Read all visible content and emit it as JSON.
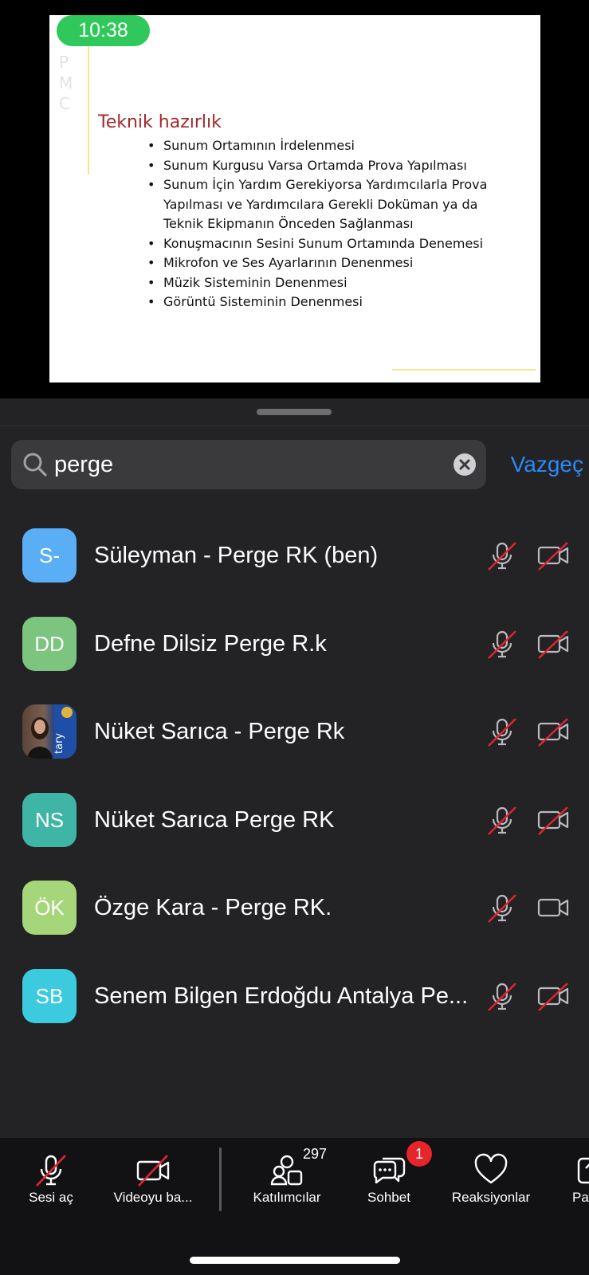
{
  "status": {
    "time": "10:38"
  },
  "slide": {
    "title": "Teknik hazırlık",
    "bullets": [
      "Sunum Ortamının İrdelenmesi",
      "Sunum Kurgusu Varsa Ortamda Prova Yapılması",
      "Sunum İçin Yardım Gerekiyorsa Yardımcılarla Prova Yapılması ve Yardımcılara Gerekli Doküman ya da Teknik Ekipmanın Önceden Sağlanması",
      "Konuşmacının Sesini Sunum Ortamında Denemesi",
      "Mikrofon ve Ses Ayarlarının Denenmesi",
      "Müzik Sisteminin Denenmesi",
      "Görüntü Sisteminin Denenmesi"
    ]
  },
  "search": {
    "value": "perge",
    "cancel_label": "Vazgeç"
  },
  "participants": [
    {
      "initials": "S-",
      "name": "Süleyman - Perge RK (ben)",
      "avatar_color": "#5aaef5",
      "mic": "muted",
      "camera": "off"
    },
    {
      "initials": "DD",
      "name": "Defne Dilsiz Perge R.k",
      "avatar_color": "#7cc57f",
      "mic": "muted",
      "camera": "off"
    },
    {
      "initials": "",
      "name": "Nüket Sarıca - Perge Rk",
      "avatar_color": "photo",
      "mic": "muted",
      "camera": "off"
    },
    {
      "initials": "NS",
      "name": "Nüket Sarıca Perge RK",
      "avatar_color": "#3fb5a6",
      "mic": "muted",
      "camera": "off"
    },
    {
      "initials": "ÖK",
      "name": "Özge Kara - Perge RK.",
      "avatar_color": "#a6d67a",
      "mic": "muted",
      "camera": "on"
    },
    {
      "initials": "SB",
      "name": "Senem Bilgen Erdoğdu Antalya Pe...",
      "avatar_color": "#3ccadf",
      "mic": "muted",
      "camera": "off"
    }
  ],
  "toolbar": {
    "unmute_label": "Sesi aç",
    "video_label": "Videoyu ba...",
    "participants_label": "Katılımcılar",
    "participants_count": "297",
    "chat_label": "Sohbet",
    "chat_badge": "1",
    "reactions_label": "Reaksiyonlar",
    "more_label": "Pay"
  },
  "colors": {
    "accent": "#2a8af6",
    "muted_slash": "#e0262f",
    "badge": "#e5252a",
    "time_pill": "#30c85a"
  }
}
